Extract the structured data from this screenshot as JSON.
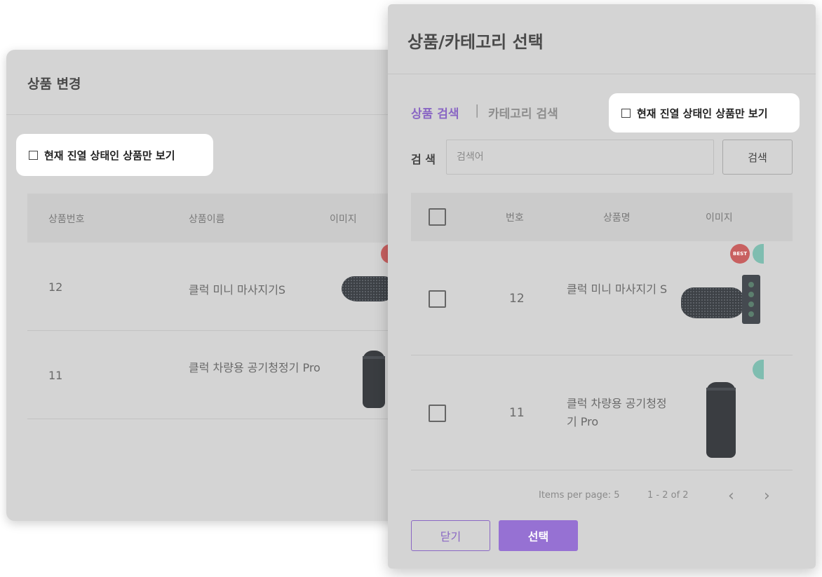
{
  "back_dialog": {
    "title": "상품 변경",
    "filter_label": "현재 진열 상태인 상품만 보기",
    "columns": [
      "상품번호",
      "상품이름",
      "이미지"
    ],
    "rows": [
      {
        "id": "12",
        "name": "클럭 미니 마사지기S"
      },
      {
        "id": "11",
        "name": "클럭 차량용 공기청정기 Pro"
      }
    ]
  },
  "front_dialog": {
    "title": "상품/카테고리 선택",
    "tabs": {
      "product": "상품 검색",
      "separator": "|",
      "category": "카테고리 검색"
    },
    "filter_label": "현재 진열 상태인 상품만 보기",
    "search": {
      "label": "검 색",
      "placeholder": "검색어",
      "button": "검색"
    },
    "columns": [
      "번호",
      "상품명",
      "이미지"
    ],
    "rows": [
      {
        "id": "12",
        "name": "클럭 미니 마사지기 S"
      },
      {
        "id": "11",
        "name": "클럭 차량용 공기청정기 Pro"
      }
    ],
    "pagination": {
      "items_per_page": "Items per page:  5",
      "range": "1 - 2 of 2",
      "prev": "‹",
      "next": "›"
    },
    "buttons": {
      "close": "닫기",
      "select": "선택"
    },
    "badges": {
      "best": "BEST"
    }
  },
  "colors": {
    "accent": "#9671d3",
    "accent_text": "#8a67c4",
    "overlay": "#d4d4d4"
  }
}
